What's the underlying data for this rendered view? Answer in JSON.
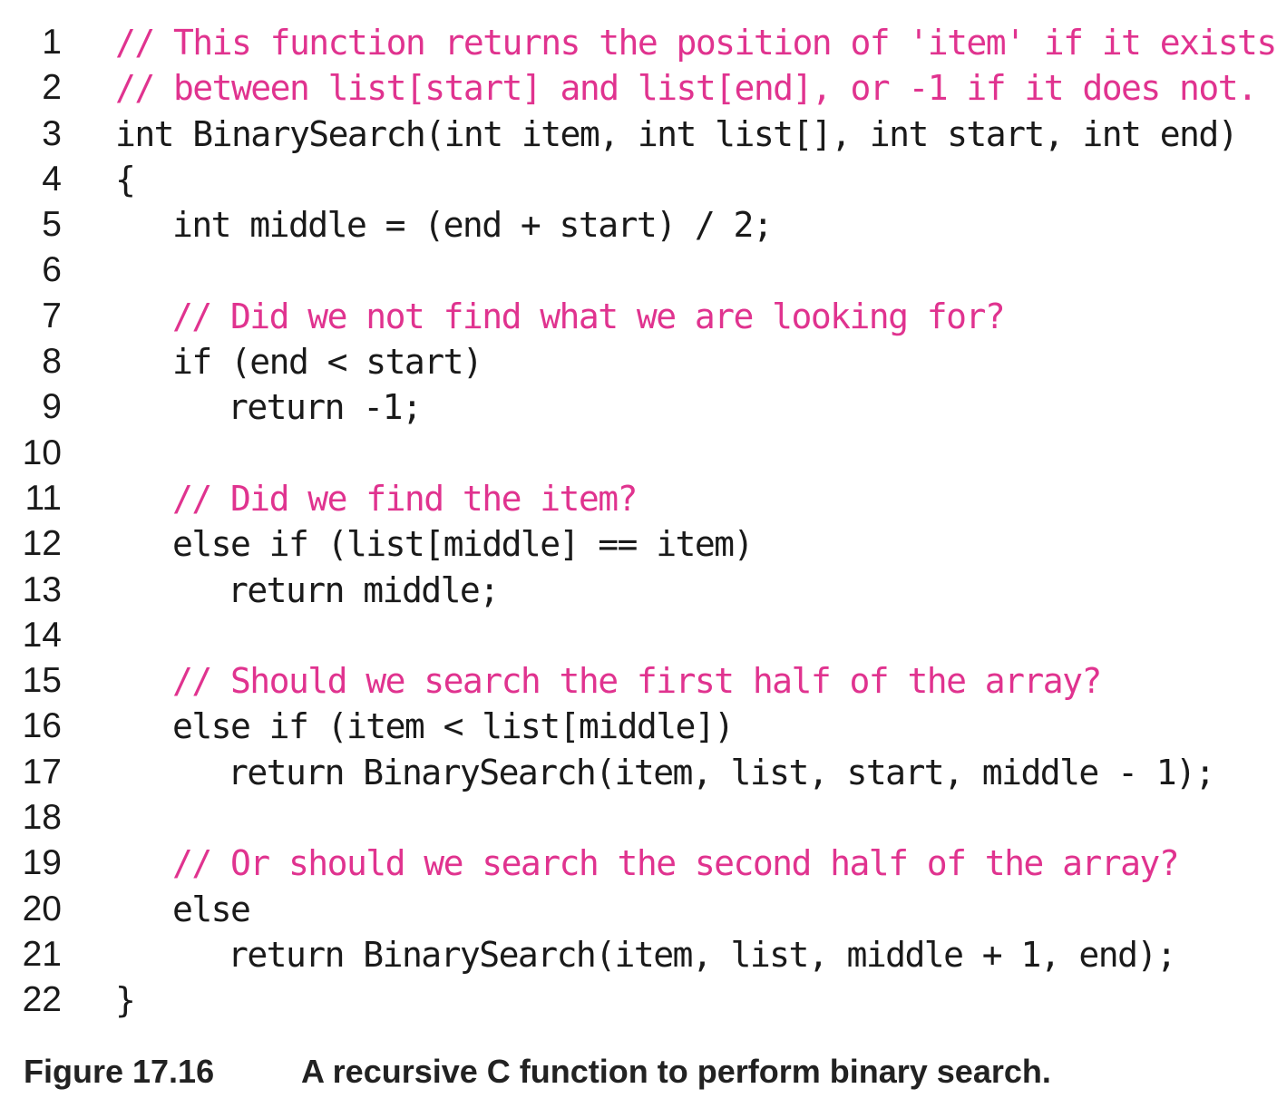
{
  "code_lines": [
    {
      "n": "1",
      "text": "// This function returns the position of 'item' if it exists",
      "kind": "comment",
      "indent": 0
    },
    {
      "n": "2",
      "text": "// between list[start] and list[end], or -1 if it does not.",
      "kind": "comment",
      "indent": 0
    },
    {
      "n": "3",
      "text": "int BinarySearch(int item, int list[], int start, int end)",
      "kind": "code",
      "indent": 0
    },
    {
      "n": "4",
      "text": "{",
      "kind": "code",
      "indent": 0
    },
    {
      "n": "5",
      "text": "int middle = (end + start) / 2;",
      "kind": "code",
      "indent": 1
    },
    {
      "n": "6",
      "text": "",
      "kind": "code",
      "indent": 0
    },
    {
      "n": "7",
      "text": "// Did we not find what we are looking for?",
      "kind": "comment",
      "indent": 1
    },
    {
      "n": "8",
      "text": "if (end < start)",
      "kind": "code",
      "indent": 1
    },
    {
      "n": "9",
      "text": "return -1;",
      "kind": "code",
      "indent": 2
    },
    {
      "n": "10",
      "text": "",
      "kind": "code",
      "indent": 0
    },
    {
      "n": "11",
      "text": "// Did we find the item?",
      "kind": "comment",
      "indent": 1
    },
    {
      "n": "12",
      "text": "else if (list[middle] == item)",
      "kind": "code",
      "indent": 1
    },
    {
      "n": "13",
      "text": "return middle;",
      "kind": "code",
      "indent": 2
    },
    {
      "n": "14",
      "text": "",
      "kind": "code",
      "indent": 0
    },
    {
      "n": "15",
      "text": "// Should we search the first half of the array?",
      "kind": "comment",
      "indent": 1
    },
    {
      "n": "16",
      "text": "else if (item < list[middle])",
      "kind": "code",
      "indent": 1
    },
    {
      "n": "17",
      "text": "return BinarySearch(item, list, start, middle - 1);",
      "kind": "code",
      "indent": 2
    },
    {
      "n": "18",
      "text": "",
      "kind": "code",
      "indent": 0
    },
    {
      "n": "19",
      "text": "// Or should we search the second half of the array?",
      "kind": "comment",
      "indent": 1
    },
    {
      "n": "20",
      "text": "else",
      "kind": "code",
      "indent": 1
    },
    {
      "n": "21",
      "text": "return BinarySearch(item, list, middle + 1, end);",
      "kind": "code",
      "indent": 2
    },
    {
      "n": "22",
      "text": "}",
      "kind": "code",
      "indent": 0
    }
  ],
  "caption": {
    "label": "Figure 17.16",
    "text": "A recursive C function to perform binary search."
  },
  "colors": {
    "comment": "#e0338f",
    "code": "#1a1a1a"
  }
}
